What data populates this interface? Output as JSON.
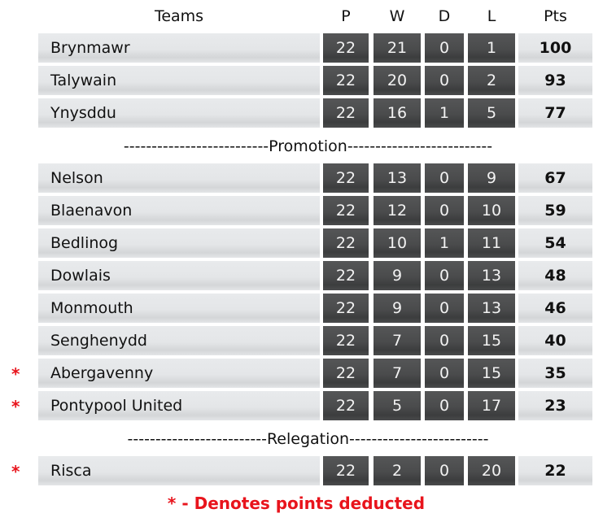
{
  "headers": {
    "team": "Teams",
    "played": "P",
    "won": "W",
    "drawn": "D",
    "lost": "L",
    "points": "Pts"
  },
  "colors": {
    "stat_cell": "#4a4b4c",
    "team_cell": "#e4e6e8",
    "deduction_marker": "#e8141c"
  },
  "deduction_marker": "*",
  "promotion_label": "--------------------------Promotion--------------------------",
  "relegation_label": "-------------------------Relegation-------------------------",
  "footnote": "* - Denotes points deducted",
  "rows": [
    {
      "team": "Brynmawr",
      "p": "22",
      "w": "21",
      "d": "0",
      "l": "1",
      "pts": "100",
      "deducted": false
    },
    {
      "team": "Talywain",
      "p": "22",
      "w": "20",
      "d": "0",
      "l": "2",
      "pts": "93",
      "deducted": false
    },
    {
      "team": "Ynysddu",
      "p": "22",
      "w": "16",
      "d": "1",
      "l": "5",
      "pts": "77",
      "deducted": false
    },
    {
      "team": "Nelson",
      "p": "22",
      "w": "13",
      "d": "0",
      "l": "9",
      "pts": "67",
      "deducted": false
    },
    {
      "team": "Blaenavon",
      "p": "22",
      "w": "12",
      "d": "0",
      "l": "10",
      "pts": "59",
      "deducted": false
    },
    {
      "team": "Bedlinog",
      "p": "22",
      "w": "10",
      "d": "1",
      "l": "11",
      "pts": "54",
      "deducted": false
    },
    {
      "team": "Dowlais",
      "p": "22",
      "w": "9",
      "d": "0",
      "l": "13",
      "pts": "48",
      "deducted": false
    },
    {
      "team": "Monmouth",
      "p": "22",
      "w": "9",
      "d": "0",
      "l": "13",
      "pts": "46",
      "deducted": false
    },
    {
      "team": "Senghenydd",
      "p": "22",
      "w": "7",
      "d": "0",
      "l": "15",
      "pts": "40",
      "deducted": false
    },
    {
      "team": "Abergavenny",
      "p": "22",
      "w": "7",
      "d": "0",
      "l": "15",
      "pts": "35",
      "deducted": true
    },
    {
      "team": "Pontypool United",
      "p": "22",
      "w": "5",
      "d": "0",
      "l": "17",
      "pts": "23",
      "deducted": true
    },
    {
      "team": "Risca",
      "p": "22",
      "w": "2",
      "d": "0",
      "l": "20",
      "pts": "22",
      "deducted": true
    }
  ]
}
